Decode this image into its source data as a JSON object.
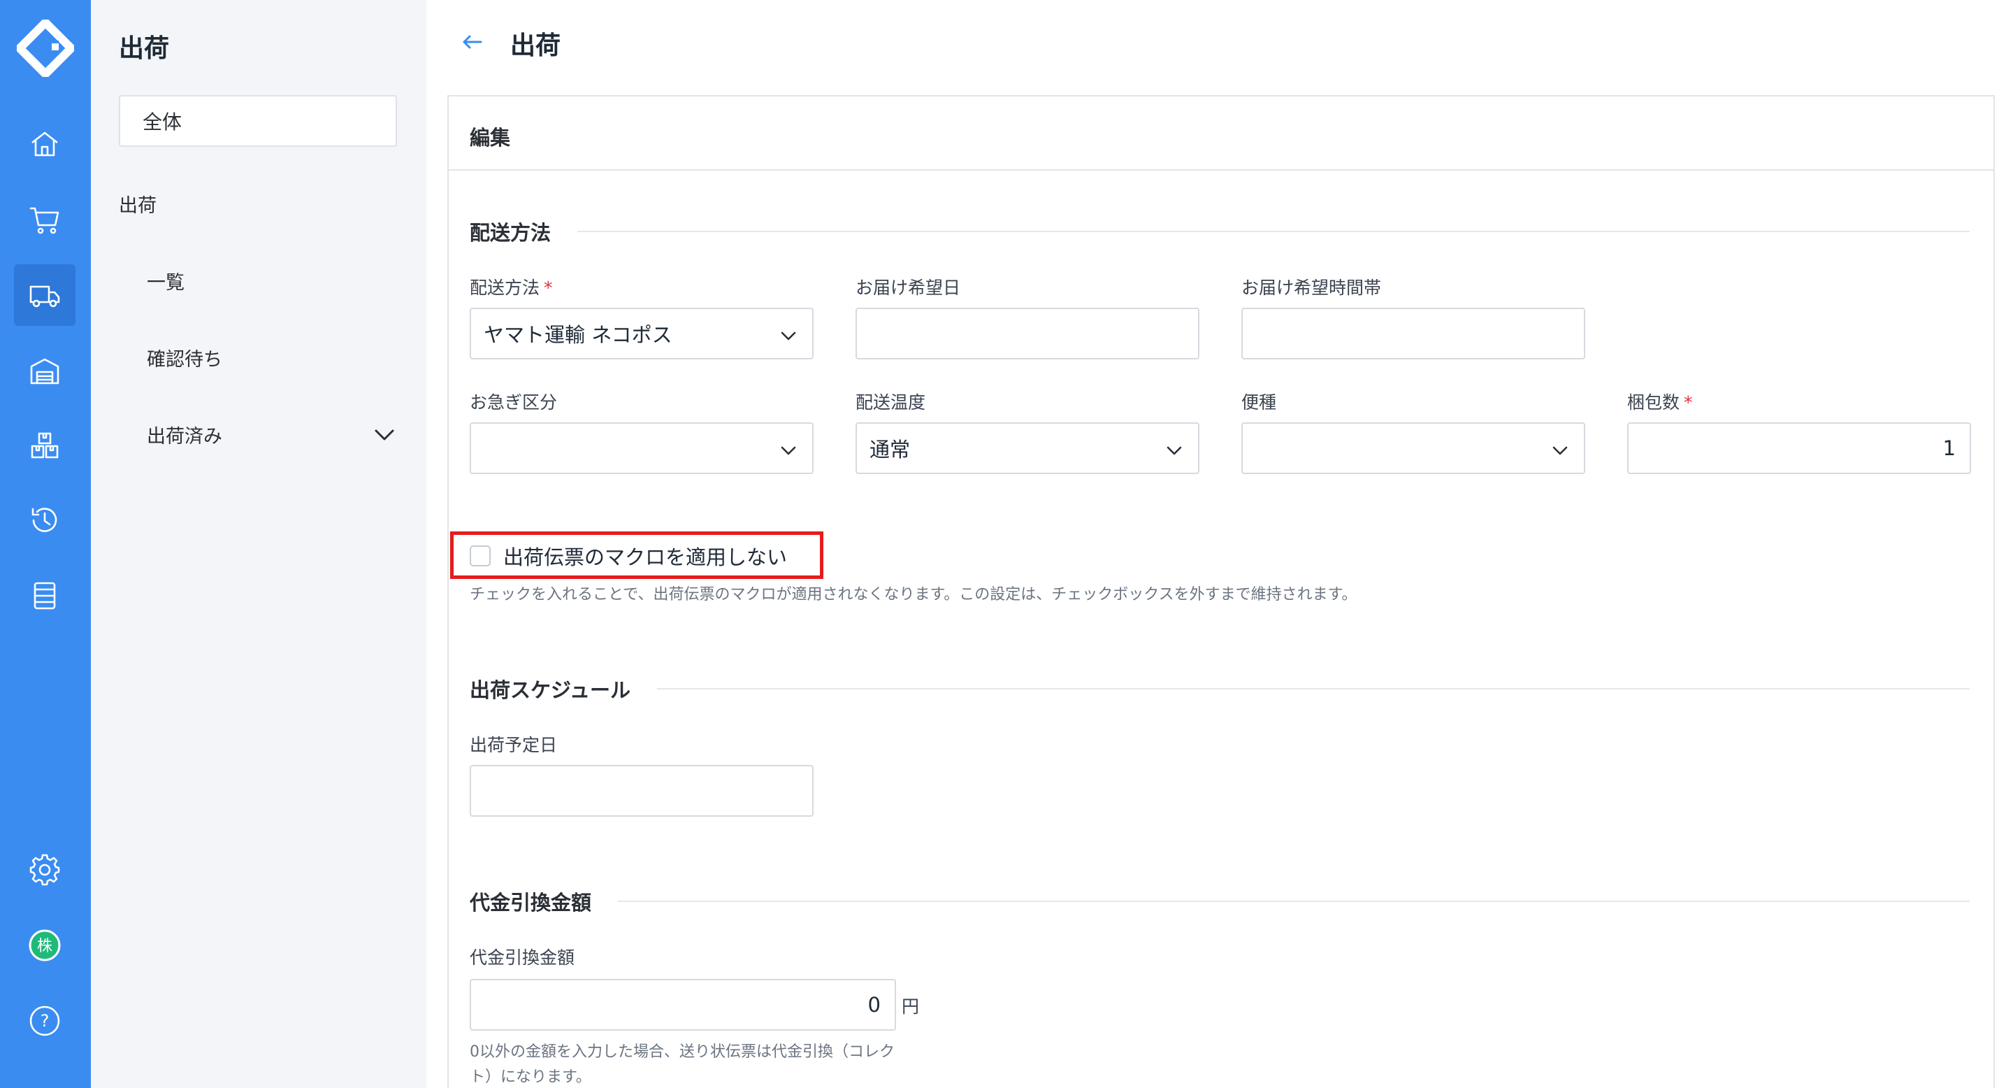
{
  "rail": {
    "logo": "app-logo",
    "items": [
      "home-icon",
      "cart-icon",
      "truck-icon",
      "warehouse-icon",
      "boxes-icon",
      "history-icon",
      "list-icon",
      "gear-icon",
      "company-badge-icon",
      "help-icon"
    ],
    "company_badge": "株",
    "help_glyph": "?"
  },
  "subnav": {
    "title": "出荷",
    "all_label": "全体",
    "group_label": "出荷",
    "items": [
      "一覧",
      "確認待ち",
      "出荷済み"
    ]
  },
  "header": {
    "title": "出荷"
  },
  "panel": {
    "title": "編集"
  },
  "delivery": {
    "section_title": "配送方法",
    "method_label": "配送方法",
    "method_value": "ヤマト運輸 ネコポス",
    "date_label": "お届け希望日",
    "date_value": "",
    "time_label": "お届け希望時間帯",
    "time_value": "",
    "urgency_label": "お急ぎ区分",
    "urgency_value": "",
    "temp_label": "配送温度",
    "temp_value": "通常",
    "service_label": "便種",
    "service_value": "",
    "count_label": "梱包数",
    "count_value": "1",
    "required_mark": "*"
  },
  "macro": {
    "checkbox_label": "出荷伝票のマクロを適用しない",
    "checked": false,
    "help": "チェックを入れることで、出荷伝票のマクロが適用されなくなります。この設定は、チェックボックスを外すまで維持されます。"
  },
  "schedule": {
    "section_title": "出荷スケジュール",
    "date_label": "出荷予定日",
    "date_value": ""
  },
  "cod": {
    "section_title": "代金引換金額",
    "amount_label": "代金引換金額",
    "amount_value": "0",
    "unit": "円",
    "help_line1": "0以外の金額を入力した場合、送り状伝票は代金引換（コレク",
    "help_line2": "ト）になります。"
  },
  "colors": {
    "rail": "#3a8cf0",
    "rail_active": "#2d78d8",
    "highlight": "#e51c1c",
    "required": "#e0343a"
  }
}
